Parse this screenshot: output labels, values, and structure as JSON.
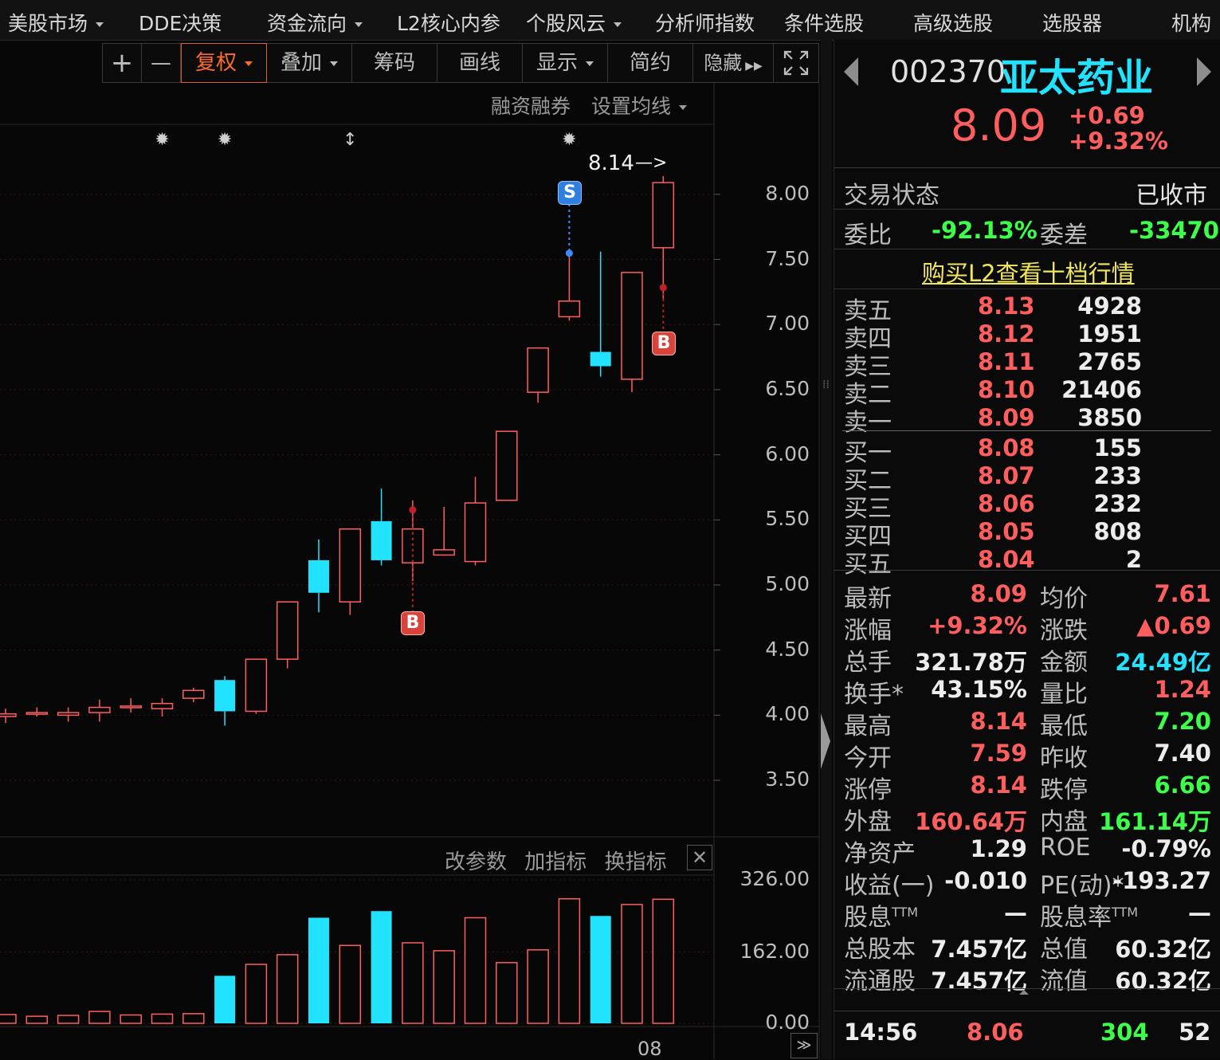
{
  "topmenu": [
    {
      "label": "美股市场",
      "dropdown": true
    },
    {
      "label": "DDE决策",
      "dropdown": false
    },
    {
      "label": "资金流向",
      "dropdown": true
    },
    {
      "label": "L2核心内参",
      "dropdown": false
    },
    {
      "label": "个股风云",
      "dropdown": true
    },
    {
      "label": "分析师指数",
      "dropdown": false
    },
    {
      "label": "条件选股",
      "dropdown": false
    },
    {
      "label": "高级选股",
      "dropdown": false
    },
    {
      "label": "选股器",
      "dropdown": false
    },
    {
      "label": "机构",
      "dropdown": false
    }
  ],
  "toolbar": {
    "plus": "+",
    "minus": "—",
    "fuquan": "复权",
    "diejia": "叠加",
    "chouma": "筹码",
    "huaxian": "画线",
    "xianshi": "显示",
    "jianyue": "简约",
    "yincang": "隐藏"
  },
  "chart_links": {
    "margin": "融资融券",
    "ma_setting": "设置均线"
  },
  "indicator_links": {
    "change_params": "改参数",
    "add_indicator": "加指标",
    "switch_indicator": "换指标"
  },
  "high_annotation": "8.14",
  "signals": {
    "s": "S",
    "b": "B"
  },
  "price_axis": [
    "8.00",
    "7.50",
    "7.00",
    "6.50",
    "6.00",
    "5.50",
    "5.00",
    "4.50",
    "4.00",
    "3.50"
  ],
  "volume_axis": [
    "326.00",
    "162.00",
    "0.00"
  ],
  "date_label": "08",
  "chart_data": {
    "type": "candlestick",
    "y_range": [
      3.28,
      8.36
    ],
    "volume_range": [
      0,
      326
    ],
    "candles": [
      {
        "o": 3.99,
        "c": 4.01,
        "h": 4.05,
        "l": 3.94,
        "color": "red"
      },
      {
        "o": 4.01,
        "c": 4.02,
        "h": 4.06,
        "l": 3.99,
        "color": "red"
      },
      {
        "o": 4.0,
        "c": 4.02,
        "h": 4.06,
        "l": 3.95,
        "color": "red"
      },
      {
        "o": 4.02,
        "c": 4.06,
        "h": 4.12,
        "l": 3.95,
        "color": "red"
      },
      {
        "o": 4.06,
        "c": 4.07,
        "h": 4.13,
        "l": 4.02,
        "color": "red"
      },
      {
        "o": 4.05,
        "c": 4.09,
        "h": 4.13,
        "l": 3.99,
        "color": "red"
      },
      {
        "o": 4.13,
        "c": 4.19,
        "h": 4.21,
        "l": 4.1,
        "color": "red"
      },
      {
        "o": 4.27,
        "c": 4.03,
        "h": 4.3,
        "l": 3.92,
        "color": "cyan"
      },
      {
        "o": 4.03,
        "c": 4.43,
        "h": 4.43,
        "l": 4.01,
        "color": "red"
      },
      {
        "o": 4.43,
        "c": 4.87,
        "h": 4.87,
        "l": 4.36,
        "color": "red"
      },
      {
        "o": 5.19,
        "c": 4.94,
        "h": 5.35,
        "l": 4.79,
        "color": "cyan"
      },
      {
        "o": 4.87,
        "c": 5.43,
        "h": 5.43,
        "l": 4.77,
        "color": "red"
      },
      {
        "o": 5.49,
        "c": 5.19,
        "h": 5.74,
        "l": 5.15,
        "color": "cyan"
      },
      {
        "o": 5.17,
        "c": 5.43,
        "h": 5.65,
        "l": 5.03,
        "color": "red"
      },
      {
        "o": 5.23,
        "c": 5.27,
        "h": 5.6,
        "l": 5.23,
        "color": "red"
      },
      {
        "o": 5.18,
        "c": 5.63,
        "h": 5.83,
        "l": 5.15,
        "color": "red"
      },
      {
        "o": 5.65,
        "c": 6.18,
        "h": 6.18,
        "l": 5.65,
        "color": "red"
      },
      {
        "o": 6.48,
        "c": 6.82,
        "h": 6.82,
        "l": 6.4,
        "color": "red"
      },
      {
        "o": 7.06,
        "c": 7.18,
        "h": 7.56,
        "l": 7.03,
        "color": "red"
      },
      {
        "o": 6.79,
        "c": 6.68,
        "h": 7.56,
        "l": 6.6,
        "color": "cyan"
      },
      {
        "o": 6.58,
        "c": 7.4,
        "h": 7.4,
        "l": 6.48,
        "color": "red"
      },
      {
        "o": 7.59,
        "c": 8.09,
        "h": 8.14,
        "l": 7.2,
        "color": "red"
      }
    ],
    "volumes": [
      20,
      16,
      18,
      27,
      19,
      21,
      22,
      108,
      134,
      156,
      240,
      177,
      255,
      183,
      165,
      240,
      138,
      167,
      283,
      244,
      270,
      282
    ]
  },
  "stock": {
    "code": "002370",
    "name": "亚太药业",
    "price": "8.09",
    "change": "+0.69",
    "change_pct": "+9.32%"
  },
  "status": {
    "label": "交易状态",
    "value": "已收市"
  },
  "weibi": {
    "label": "委比",
    "value": "-92.13%",
    "diff_label": "委差",
    "diff_value": "-33470"
  },
  "l2_link": "购买L2查看十档行情",
  "asks": [
    {
      "label": "卖五",
      "price": "8.13",
      "vol": "4928"
    },
    {
      "label": "卖四",
      "price": "8.12",
      "vol": "1951"
    },
    {
      "label": "卖三",
      "price": "8.11",
      "vol": "2765"
    },
    {
      "label": "卖二",
      "price": "8.10",
      "vol": "21406"
    },
    {
      "label": "卖一",
      "price": "8.09",
      "vol": "3850"
    }
  ],
  "bids": [
    {
      "label": "买一",
      "price": "8.08",
      "vol": "155"
    },
    {
      "label": "买二",
      "price": "8.07",
      "vol": "233"
    },
    {
      "label": "买三",
      "price": "8.06",
      "vol": "232"
    },
    {
      "label": "买四",
      "price": "8.05",
      "vol": "808"
    },
    {
      "label": "买五",
      "price": "8.04",
      "vol": "2"
    }
  ],
  "stats": [
    {
      "l1": "最新",
      "v1": "8.09",
      "c1": "red",
      "l2": "均价",
      "v2": "7.61",
      "c2": "red"
    },
    {
      "l1": "涨幅",
      "v1": "+9.32%",
      "c1": "red",
      "l2": "涨跌",
      "v2": "▲0.69",
      "c2": "red"
    },
    {
      "l1": "总手",
      "v1": "321.78万",
      "c1": "white",
      "l2": "金额",
      "v2": "24.49亿",
      "c2": "cyan"
    },
    {
      "l1": "换手*",
      "v1": "43.15%",
      "c1": "white",
      "l2": "量比",
      "v2": "1.24",
      "c2": "red"
    },
    {
      "l1": "最高",
      "v1": "8.14",
      "c1": "red",
      "l2": "最低",
      "v2": "7.20",
      "c2": "green"
    },
    {
      "l1": "今开",
      "v1": "7.59",
      "c1": "red",
      "l2": "昨收",
      "v2": "7.40",
      "c2": "white"
    },
    {
      "l1": "涨停",
      "v1": "8.14",
      "c1": "red",
      "l2": "跌停",
      "v2": "6.66",
      "c2": "green"
    },
    {
      "l1": "外盘",
      "v1": "160.64万",
      "c1": "red",
      "l2": "内盘",
      "v2": "161.14万",
      "c2": "green"
    },
    {
      "l1": "净资产",
      "v1": "1.29",
      "c1": "white",
      "l2": "ROE",
      "v2": "-0.79%",
      "c2": "white"
    },
    {
      "l1": "收益(一)",
      "v1": "-0.010",
      "c1": "white",
      "l2": "PE(动)*",
      "v2": "-193.27",
      "c2": "white"
    },
    {
      "l1": "股息",
      "sup1": "TTM",
      "v1": "—",
      "c1": "white",
      "l2": "股息率",
      "sup2": "TTM",
      "v2": "—",
      "c2": "white"
    },
    {
      "l1": "总股本",
      "v1": "7.457亿",
      "c1": "white",
      "l2": "总值",
      "v2": "60.32亿",
      "c2": "white"
    },
    {
      "l1": "流通股",
      "v1": "7.457亿",
      "c1": "white",
      "l2": "流值",
      "v2": "60.32亿",
      "c2": "white"
    }
  ],
  "tick": {
    "time": "14:56",
    "price": "8.06",
    "vol": "304",
    "count": "52"
  },
  "colors": {
    "up": "#ff5e5e",
    "down": "#21e3ff",
    "accent": "#ff6a2b",
    "link": "#f1e65a"
  }
}
